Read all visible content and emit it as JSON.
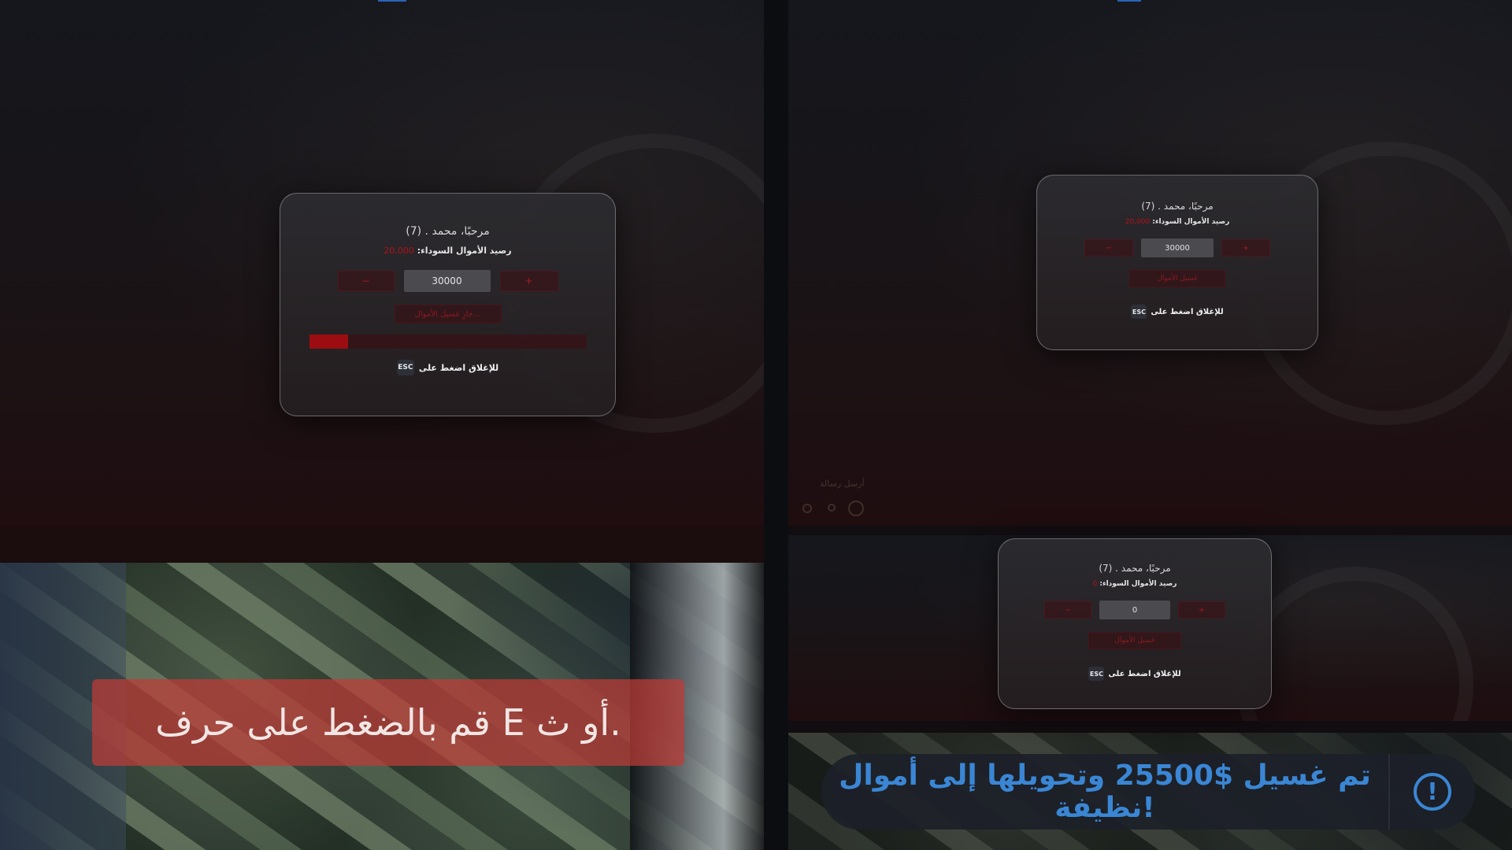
{
  "dialogs": [
    {
      "title": "مرحبًا، محمد . (7)",
      "balance_label": "رصيد الأموال السوداء:",
      "balance_value": "20,000",
      "minus_label": "−",
      "plus_label": "+",
      "amount": "30000",
      "launder_label": "جارٍ غسيل الأموال...",
      "progress": 0.14,
      "esc_prefix": "للإغلاق اضغط على",
      "esc_key": "ESC"
    },
    {
      "title": "مرحبًا، محمد . (7)",
      "balance_label": "رصيد الأموال السوداء:",
      "balance_value": "20,000",
      "minus_label": "−",
      "plus_label": "+",
      "amount": "30000",
      "launder_label": "غسيل الأموال",
      "esc_prefix": "للإغلاق اضغط على",
      "esc_key": "ESC"
    },
    {
      "title": "مرحبًا، محمد . (7)",
      "balance_label": "رصيد الأموال السوداء:",
      "balance_value": "0",
      "minus_label": "−",
      "plus_label": "+",
      "amount": "0",
      "launder_label": "غسيل الأموال",
      "esc_prefix": "للإغلاق اضغط على",
      "esc_key": "ESC"
    }
  ],
  "hint_banner": "قم بالضغط على حرف E أو ث.",
  "notification": {
    "text": "تم غسيل $25500 وتحويلها إلى أموال نظيفة!",
    "icon": "exclamation-circle-icon"
  },
  "chat_hint": "أرسل رسالة",
  "colors": {
    "accent_red": "#9c0d12",
    "notify_blue": "#3a86d4"
  }
}
